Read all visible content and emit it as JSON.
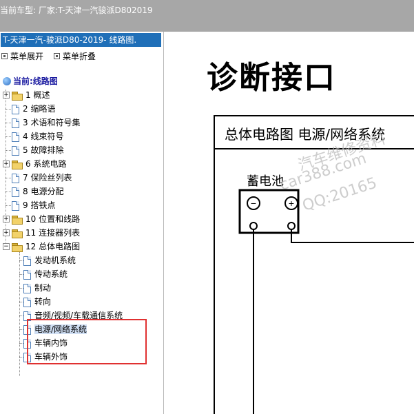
{
  "titlebar": {
    "text": "当前车型:  厂家:T-天津一汽骏派D802019"
  },
  "panel": {
    "header": "T-天津一汽-骏派D80-2019- 线路图.",
    "expand_label": "菜单展开",
    "collapse_label": "菜单折叠",
    "current_label": "当前:线路图"
  },
  "tree": {
    "items": [
      {
        "label": "1 概述"
      },
      {
        "label": "2 缩略语"
      },
      {
        "label": "3 术语和符号集"
      },
      {
        "label": "4 线束符号"
      },
      {
        "label": "5 故障排除"
      },
      {
        "label": "6 系统电路"
      },
      {
        "label": "7 保险丝列表"
      },
      {
        "label": "8 电源分配"
      },
      {
        "label": "9 搭铁点"
      },
      {
        "label": "10 位置和线路"
      },
      {
        "label": "11 连接器列表"
      },
      {
        "label": "12 总体电路图"
      }
    ],
    "children": [
      {
        "label": "发动机系统"
      },
      {
        "label": "传动系统"
      },
      {
        "label": "制动"
      },
      {
        "label": "转向"
      },
      {
        "label": "音频/视频/车载通信系统"
      },
      {
        "label": "电源/网络系统"
      },
      {
        "label": "车辆内饰"
      },
      {
        "label": "车辆外饰"
      }
    ]
  },
  "content": {
    "page_title": "诊断接口",
    "diagram_title": "总体电路图  电源/网络系统",
    "battery_label": "蓄电池",
    "battery_minus": "−",
    "battery_plus": "+",
    "watermark": [
      "汽车维修资料",
      "car388.com",
      "QQ:20165"
    ]
  },
  "colors": {
    "titlebar_bg": "#a7a7a7",
    "panel_header_bg": "#1f6fb8",
    "highlight_box": "#e03030",
    "selected_bg": "#cfdef3"
  }
}
